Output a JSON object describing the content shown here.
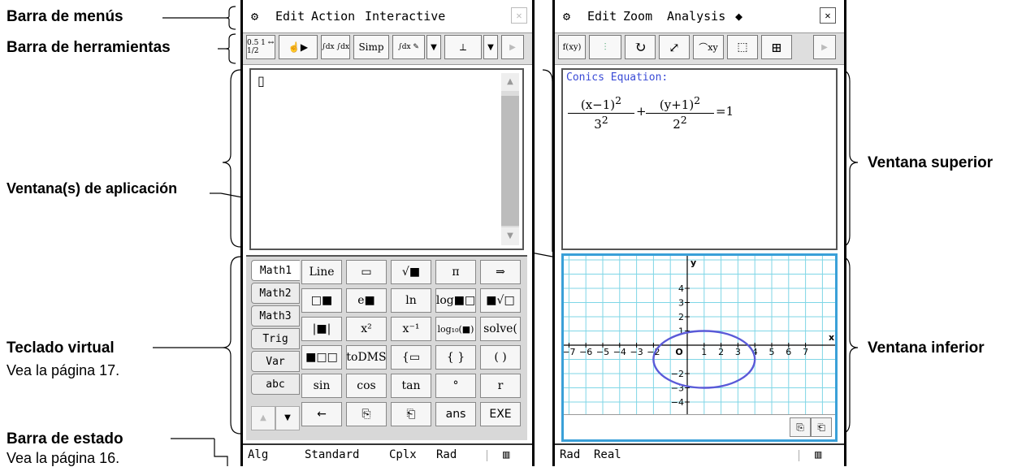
{
  "annotations": {
    "menu_bar": "Barra de menús",
    "toolbar": "Barra de herramientas",
    "app_windows": "Ventana(s) de aplicación",
    "virtual_keyboard": "Teclado virtual",
    "virtual_keyboard_note": "Vea la página 17.",
    "status_bar": "Barra de estado",
    "status_bar_note": "Vea la página 16.",
    "upper_window": "Ventana superior",
    "lower_window": "Ventana inferior"
  },
  "left_screen": {
    "menu": [
      "Edit",
      "Action",
      "Interactive"
    ],
    "toolbar": [
      "0.5 1 ↔ 1/2",
      "☝▶",
      "∫dx ∫dx",
      "Simp",
      "∫dx ✎",
      "▼",
      "⟂",
      "▼",
      "▶"
    ],
    "cursor": "▯",
    "keyboard_tabs": [
      "Math1",
      "Math2",
      "Math3",
      "Trig",
      "Var",
      "abc"
    ],
    "keys": [
      [
        "Line",
        "▭",
        "√■",
        "π",
        "⇒"
      ],
      [
        "□■",
        "e■",
        "ln",
        "log■□",
        "■√□"
      ],
      [
        "|■|",
        "x²",
        "x⁻¹",
        "log₁₀(■)",
        "solve("
      ],
      [
        "■□□",
        "toDMS",
        "{▭",
        "{ }",
        "( )"
      ],
      [
        "sin",
        "cos",
        "tan",
        "°",
        "r"
      ],
      [
        "←",
        "⎘",
        "⎗",
        "ans",
        "EXE"
      ]
    ],
    "arrows": [
      "▲",
      "▼"
    ],
    "status": [
      "Alg",
      "Standard",
      "Cplx",
      "Rad"
    ]
  },
  "right_screen": {
    "menu": [
      "Edit",
      "Zoom",
      "Analysis",
      "◆"
    ],
    "toolbar": [
      "f(xy)",
      "⫶",
      "↻",
      "⤢",
      "⌒xy",
      "⬚",
      "⊞",
      "▶"
    ],
    "conics_title": "Conics Equation:",
    "equation": {
      "num1": "(x−1)",
      "den1": "3",
      "num2": "(y+1)",
      "den2": "2",
      "exp": "2",
      "rhs": "=1",
      "plus": "+"
    },
    "graph": {
      "x_ticks": [
        "−7",
        "−6",
        "−5",
        "−4",
        "−3",
        "−2",
        "O",
        "1",
        "2",
        "3",
        "4",
        "5",
        "6",
        "7"
      ],
      "y_ticks": [
        "4",
        "3",
        "2",
        "1",
        "−2",
        "−3",
        "−4"
      ],
      "x_label": "x",
      "y_label": "y",
      "ellipse": {
        "h": 1,
        "k": -1,
        "a": 3,
        "b": 2
      }
    },
    "status": [
      "Rad",
      "Real"
    ]
  }
}
